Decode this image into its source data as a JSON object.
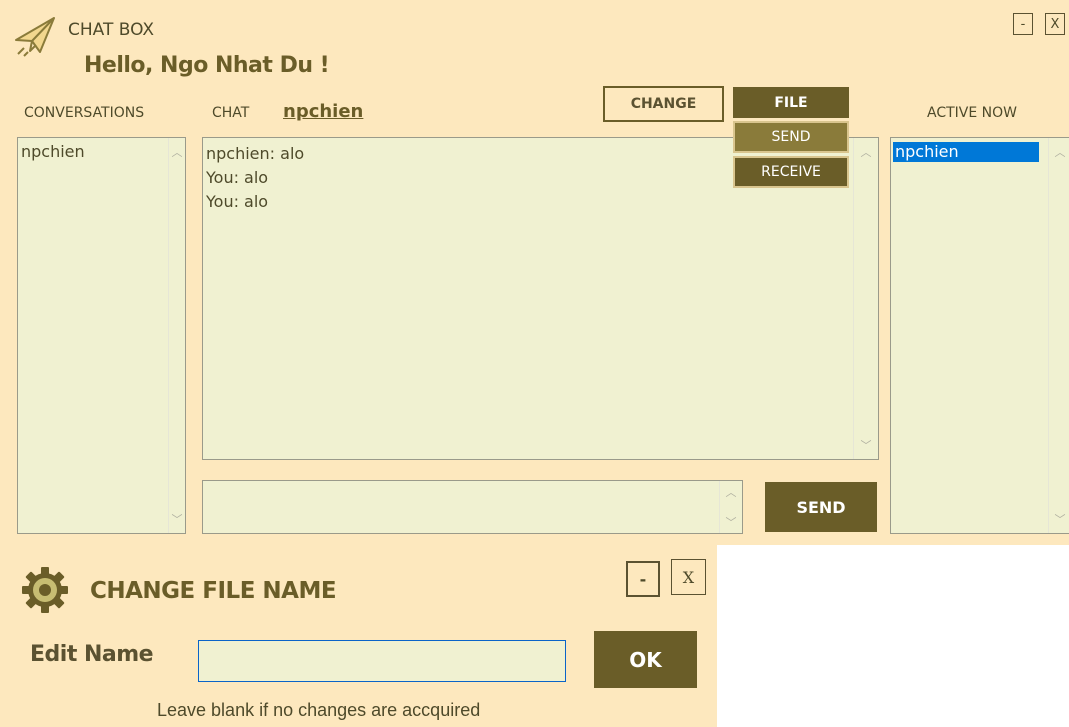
{
  "main_window": {
    "title": "CHAT BOX",
    "greeting": "Hello, Ngo Nhat Du !",
    "controls": {
      "minimize": "-",
      "close": "X"
    },
    "conversations_label": "CONVERSATIONS",
    "conversations": [
      "npchien"
    ],
    "chat_label": "CHAT",
    "chat_partner": "npchien",
    "change_button": "CHANGE",
    "file_menu": {
      "file": "FILE",
      "send": "SEND",
      "receive": "RECEIVE"
    },
    "messages": [
      "npchien: alo",
      "You: alo",
      "You: alo"
    ],
    "message_input": "",
    "send_button": "SEND",
    "active_label": "ACTIVE NOW",
    "active_users": [
      "npchien"
    ]
  },
  "dialog": {
    "title": "CHANGE FILE NAME",
    "controls": {
      "minimize": "-",
      "close": "X"
    },
    "edit_label": "Edit Name",
    "edit_value": "",
    "ok_button": "OK",
    "hint": "Leave blank if no changes are accquired"
  },
  "colors": {
    "background": "#fde8be",
    "panel": "#f0f1d1",
    "accent": "#6a5d28",
    "selection": "#0078d7"
  },
  "icons": {
    "title": "paper-plane-icon",
    "dialog": "gear-icon"
  }
}
